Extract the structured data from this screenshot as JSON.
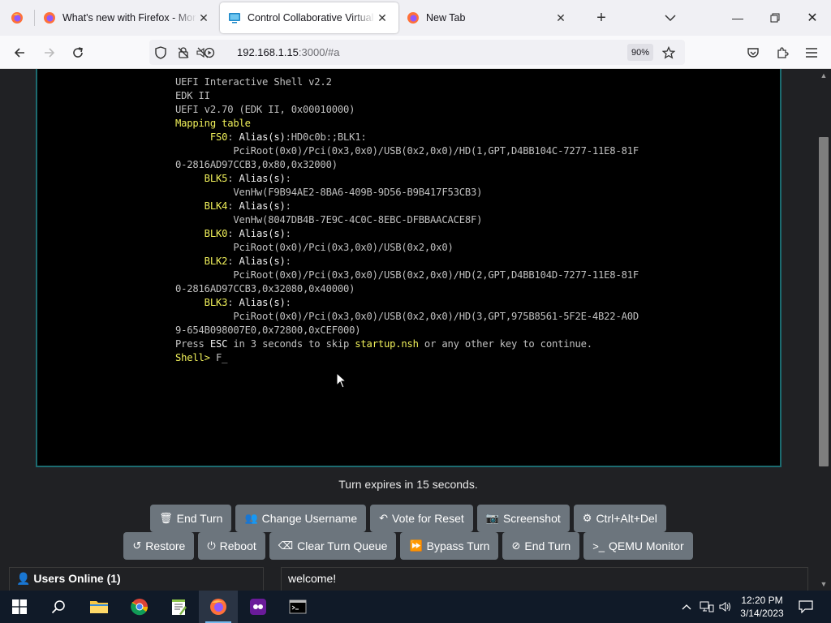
{
  "browser": {
    "tabs": [
      {
        "title": "What's new with Firefox - More",
        "icon": "firefox-icon"
      },
      {
        "title": "Control Collaborative Virtual M",
        "icon": "monitor-icon",
        "active": true
      },
      {
        "title": "New Tab",
        "icon": "firefox-icon"
      }
    ],
    "url_host": "192.168.1.15",
    "url_rest": ":3000/#a",
    "zoom": "90%"
  },
  "console": {
    "lines": [
      [
        {
          "t": "UEFI Interactive Shell v2.2",
          "c": ""
        }
      ],
      [
        {
          "t": "EDK II",
          "c": ""
        }
      ],
      [
        {
          "t": "UEFI v2.70 (EDK II, 0x00010000)",
          "c": ""
        }
      ],
      [
        {
          "t": "Mapping table",
          "c": "y"
        }
      ],
      [
        {
          "t": "      FS0",
          "c": "y"
        },
        {
          "t": ": ",
          "c": ""
        },
        {
          "t": "Alias(s)",
          "c": "w"
        },
        {
          "t": ":HD0c0b:;BLK1:",
          "c": ""
        }
      ],
      [
        {
          "t": "          PciRoot(0x0)/Pci(0x3,0x0)/USB(0x2,0x0)/HD(1,GPT,D4BB104C-7277-11E8-81F",
          "c": ""
        }
      ],
      [
        {
          "t": "0-2816AD97CCB3,0x80,0x32000)",
          "c": ""
        }
      ],
      [
        {
          "t": "     BLK5",
          "c": "y"
        },
        {
          "t": ": ",
          "c": ""
        },
        {
          "t": "Alias(s)",
          "c": "w"
        },
        {
          "t": ":",
          "c": ""
        }
      ],
      [
        {
          "t": "          VenHw(F9B94AE2-8BA6-409B-9D56-B9B417F53CB3)",
          "c": ""
        }
      ],
      [
        {
          "t": "     BLK4",
          "c": "y"
        },
        {
          "t": ": ",
          "c": ""
        },
        {
          "t": "Alias(s)",
          "c": "w"
        },
        {
          "t": ":",
          "c": ""
        }
      ],
      [
        {
          "t": "          VenHw(8047DB4B-7E9C-4C0C-8EBC-DFBBAACACE8F)",
          "c": ""
        }
      ],
      [
        {
          "t": "     BLK0",
          "c": "y"
        },
        {
          "t": ": ",
          "c": ""
        },
        {
          "t": "Alias(s)",
          "c": "w"
        },
        {
          "t": ":",
          "c": ""
        }
      ],
      [
        {
          "t": "          PciRoot(0x0)/Pci(0x3,0x0)/USB(0x2,0x0)",
          "c": ""
        }
      ],
      [
        {
          "t": "     BLK2",
          "c": "y"
        },
        {
          "t": ": ",
          "c": ""
        },
        {
          "t": "Alias(s)",
          "c": "w"
        },
        {
          "t": ":",
          "c": ""
        }
      ],
      [
        {
          "t": "          PciRoot(0x0)/Pci(0x3,0x0)/USB(0x2,0x0)/HD(2,GPT,D4BB104D-7277-11E8-81F",
          "c": ""
        }
      ],
      [
        {
          "t": "0-2816AD97CCB3,0x32080,0x40000)",
          "c": ""
        }
      ],
      [
        {
          "t": "     BLK3",
          "c": "y"
        },
        {
          "t": ": ",
          "c": ""
        },
        {
          "t": "Alias(s)",
          "c": "w"
        },
        {
          "t": ":",
          "c": ""
        }
      ],
      [
        {
          "t": "          PciRoot(0x0)/Pci(0x3,0x0)/USB(0x2,0x0)/HD(3,GPT,975B8561-5F2E-4B22-A0D",
          "c": ""
        }
      ],
      [
        {
          "t": "9-654B098007E0,0x72800,0xCEF000)",
          "c": ""
        }
      ],
      [
        {
          "t": "Press ",
          "c": ""
        },
        {
          "t": "ESC",
          "c": "w"
        },
        {
          "t": " in 3 seconds to skip ",
          "c": ""
        },
        {
          "t": "startup.nsh",
          "c": "y"
        },
        {
          "t": " or any other key to continue.",
          "c": ""
        }
      ],
      [
        {
          "t": "Shell> ",
          "c": "y"
        },
        {
          "t": "F_",
          "c": ""
        }
      ]
    ]
  },
  "turn_message": "Turn expires in 15 seconds.",
  "buttons_row1": [
    {
      "label": "End Turn",
      "icon": "trash-icon",
      "glyph": "🗑"
    },
    {
      "label": "Change Username",
      "icon": "users-icon",
      "glyph": "👥"
    },
    {
      "label": "Vote for Reset",
      "icon": "undo-icon",
      "glyph": "↶"
    },
    {
      "label": "Screenshot",
      "icon": "camera-icon",
      "glyph": "📷"
    },
    {
      "label": "Ctrl+Alt+Del",
      "icon": "gear-icon",
      "glyph": "⚙"
    }
  ],
  "buttons_row2": [
    {
      "label": "Restore",
      "icon": "restore-icon",
      "glyph": "↺"
    },
    {
      "label": "Reboot",
      "icon": "power-icon",
      "glyph": "⏻"
    },
    {
      "label": "Clear Turn Queue",
      "icon": "eraser-icon",
      "glyph": "⌫"
    },
    {
      "label": "Bypass Turn",
      "icon": "forward-icon",
      "glyph": "⏩"
    },
    {
      "label": "End Turn",
      "icon": "ban-icon",
      "glyph": "⊘"
    },
    {
      "label": "QEMU Monitor",
      "icon": "terminal-icon",
      "glyph": ">_"
    }
  ],
  "users_online": "Users Online (1)",
  "chat_message": "welcome!",
  "taskbar": {
    "time": "12:20 PM",
    "date": "3/14/2023"
  }
}
